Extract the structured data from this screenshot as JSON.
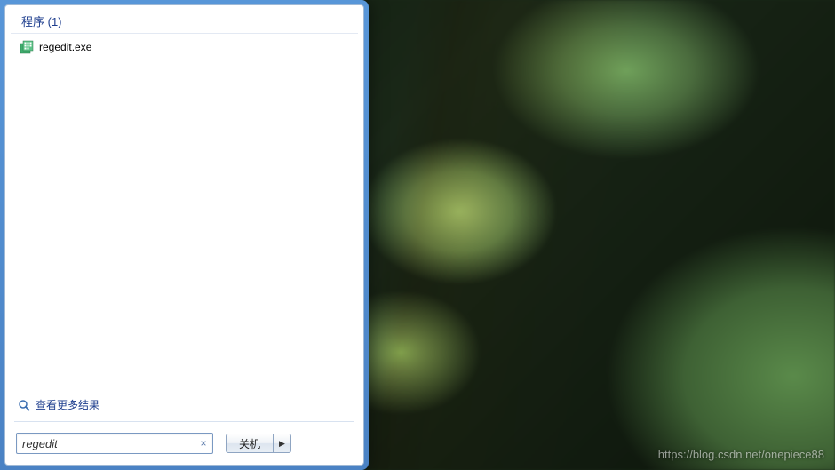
{
  "sections": {
    "programs": {
      "header": "程序 (1)",
      "items": [
        {
          "label": "regedit.exe",
          "icon": "regedit-icon"
        }
      ]
    }
  },
  "see_more": "查看更多结果",
  "search": {
    "value": "regedit",
    "clear_glyph": "×"
  },
  "shutdown": {
    "label": "关机",
    "arrow": "▶"
  },
  "watermark": "https://blog.csdn.net/onepiece88"
}
